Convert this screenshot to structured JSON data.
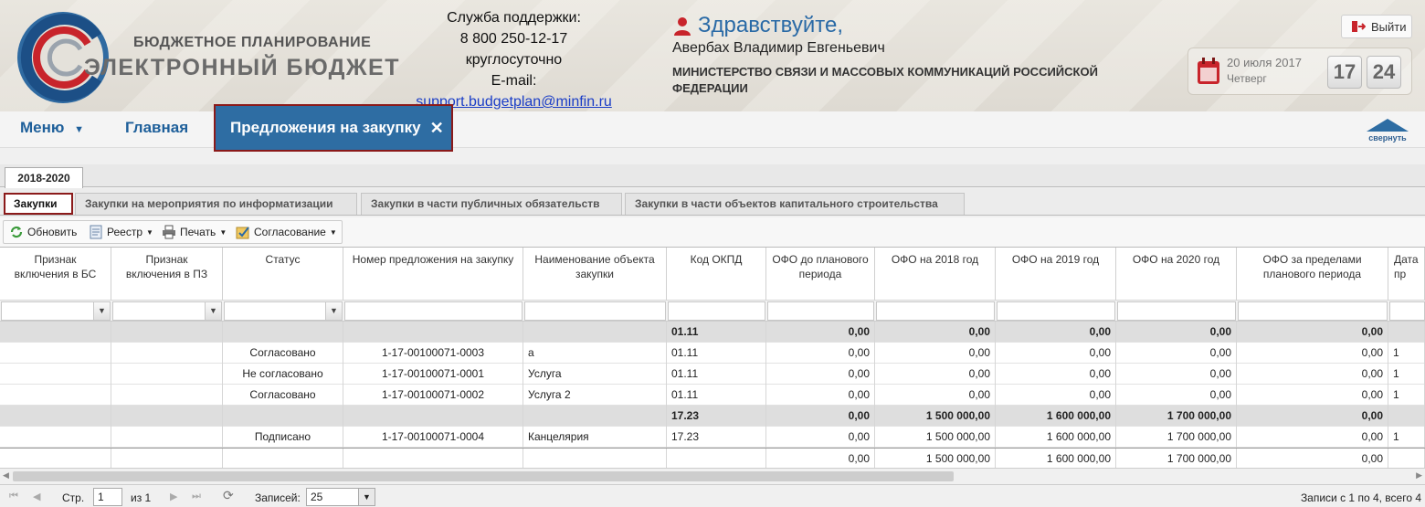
{
  "header": {
    "brand_line1": "БЮДЖЕТНОЕ ПЛАНИРОВАНИЕ",
    "brand_line2": "ЭЛЕКТРОННЫЙ БЮДЖЕТ",
    "support": {
      "title": "Служба поддержки:",
      "phone": "8 800 250-12-17",
      "hours": "круглосуточно",
      "email_label": "E-mail:",
      "email": "support.budgetplan@minfin.ru"
    },
    "greeting": "Здравствуйте,",
    "user_name": "Авербах Владимир Евгеньевич",
    "organization": "МИНИСТЕРСТВО СВЯЗИ И МАССОВЫХ КОММУНИКАЦИЙ РОССИЙСКОЙ ФЕДЕРАЦИИ",
    "logout_label": "Выйти",
    "date": "20 июля 2017",
    "weekday": "Четверг",
    "hours": "17",
    "minutes": "24"
  },
  "nav": {
    "menu_label": "Меню",
    "home_label": "Главная",
    "active_tab": "Предложения на закупку",
    "collapse_label": "свернуть"
  },
  "year_tab": "2018-2020",
  "inner_tabs": [
    "Закупки",
    "Закупки на мероприятия по информатизации",
    "Закупки в части публичных обязательств",
    "Закупки в части объектов капитального строительства"
  ],
  "toolbar": {
    "refresh": "Обновить",
    "registry": "Реестр",
    "print": "Печать",
    "approval": "Согласование"
  },
  "columns": [
    "Признак включения в БС",
    "Признак включения в ПЗ",
    "Статус",
    "Номер предложения на закупку",
    "Наименование объекта закупки",
    "Код ОКПД",
    "ОФО до планового периода",
    "ОФО на 2018 год",
    "ОФО на 2019 год",
    "ОФО на 2020 год",
    "ОФО за пределами планового периода",
    "Дата пр"
  ],
  "rows": [
    {
      "type": "group",
      "status": "",
      "number": "",
      "name": "",
      "okpd": "01.11",
      "ofo_before": "0,00",
      "ofo_2018": "0,00",
      "ofo_2019": "0,00",
      "ofo_2020": "0,00",
      "ofo_after": "0,00",
      "extra": ""
    },
    {
      "type": "data",
      "status": "Согласовано",
      "number": "1-17-00100071-0003",
      "name": "а",
      "okpd": "01.11",
      "ofo_before": "0,00",
      "ofo_2018": "0,00",
      "ofo_2019": "0,00",
      "ofo_2020": "0,00",
      "ofo_after": "0,00",
      "extra": "1"
    },
    {
      "type": "data",
      "status": "Не согласовано",
      "number": "1-17-00100071-0001",
      "name": "Услуга",
      "okpd": "01.11",
      "ofo_before": "0,00",
      "ofo_2018": "0,00",
      "ofo_2019": "0,00",
      "ofo_2020": "0,00",
      "ofo_after": "0,00",
      "extra": "1"
    },
    {
      "type": "data",
      "status": "Согласовано",
      "number": "1-17-00100071-0002",
      "name": "Услуга 2",
      "okpd": "01.11",
      "ofo_before": "0,00",
      "ofo_2018": "0,00",
      "ofo_2019": "0,00",
      "ofo_2020": "0,00",
      "ofo_after": "0,00",
      "extra": "1"
    },
    {
      "type": "group",
      "status": "",
      "number": "",
      "name": "",
      "okpd": "17.23",
      "ofo_before": "0,00",
      "ofo_2018": "1 500 000,00",
      "ofo_2019": "1 600 000,00",
      "ofo_2020": "1 700 000,00",
      "ofo_after": "0,00",
      "extra": ""
    },
    {
      "type": "data",
      "status": "Подписано",
      "number": "1-17-00100071-0004",
      "name": "Канцелярия",
      "okpd": "17.23",
      "ofo_before": "0,00",
      "ofo_2018": "1 500 000,00",
      "ofo_2019": "1 600 000,00",
      "ofo_2020": "1 700 000,00",
      "ofo_after": "0,00",
      "extra": "1"
    },
    {
      "type": "total",
      "status": "",
      "number": "",
      "name": "",
      "okpd": "",
      "ofo_before": "0,00",
      "ofo_2018": "1 500 000,00",
      "ofo_2019": "1 600 000,00",
      "ofo_2020": "1 700 000,00",
      "ofo_after": "0,00",
      "extra": ""
    }
  ],
  "pager": {
    "page_label": "Стр.",
    "page_value": "1",
    "of_label": "из 1",
    "records_label": "Записей:",
    "records_value": "25",
    "summary": "Записи с 1 по 4, всего 4"
  }
}
